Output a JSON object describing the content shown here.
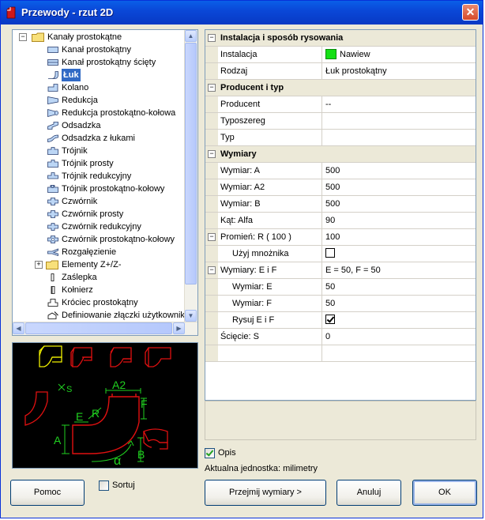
{
  "window": {
    "title": "Przewody - rzut 2D"
  },
  "tree": {
    "root_label": "Kanały prostokątne",
    "items": [
      {
        "label": "Kanał prostokątny",
        "icon": "rect-duct-icon"
      },
      {
        "label": "Kanał prostokątny ścięty",
        "icon": "rect-duct-cut-icon"
      },
      {
        "label": "Łuk",
        "icon": "bend-icon"
      },
      {
        "label": "Kolano",
        "icon": "elbow-icon"
      },
      {
        "label": "Redukcja",
        "icon": "reducer-icon"
      },
      {
        "label": "Redukcja prostokątno-kołowa",
        "icon": "rect-round-reducer-icon"
      },
      {
        "label": "Odsadzka",
        "icon": "offset-icon"
      },
      {
        "label": "Odsadzka z łukami",
        "icon": "offset-bends-icon"
      },
      {
        "label": "Trójnik",
        "icon": "tee-icon"
      },
      {
        "label": "Trójnik prosty",
        "icon": "tee-straight-icon"
      },
      {
        "label": "Trójnik redukcyjny",
        "icon": "tee-reducing-icon"
      },
      {
        "label": "Trójnik prostokątno-kołowy",
        "icon": "tee-rect-round-icon"
      },
      {
        "label": "Czwórnik",
        "icon": "cross-icon"
      },
      {
        "label": "Czwórnik prosty",
        "icon": "cross-straight-icon"
      },
      {
        "label": "Czwórnik redukcyjny",
        "icon": "cross-reducing-icon"
      },
      {
        "label": "Czwórnik prostokątno-kołowy",
        "icon": "cross-rect-round-icon"
      },
      {
        "label": "Rozgałęzienie",
        "icon": "branch-icon"
      }
    ],
    "folder2_label": "Elementy Z+/Z-",
    "items2": [
      {
        "label": "Zaślepka",
        "icon": "cap-icon"
      },
      {
        "label": "Kołnierz",
        "icon": "flange-icon"
      },
      {
        "label": "Króciec prostokątny",
        "icon": "spigot-icon"
      },
      {
        "label": "Definiowanie złączki użytkownik",
        "icon": "user-fitting-icon"
      }
    ]
  },
  "preview": {
    "labels": {
      "a2": "A2",
      "e": "E",
      "r": "R",
      "f": "F",
      "a": "A",
      "b": "B",
      "s": "S",
      "alpha": "α"
    },
    "colors": {
      "red": "#e01010",
      "yellow": "#f0f000",
      "green": "#20d020"
    }
  },
  "properties": {
    "cat1": "Instalacja i sposób rysowania",
    "instalacja_label": "Instalacja",
    "instalacja_value": "Nawiew",
    "instalacja_color": "#14e014",
    "rodzaj_label": "Rodzaj",
    "rodzaj_value": "Łuk prostokątny",
    "cat2": "Producent i typ",
    "producent_label": "Producent",
    "producent_value": "--",
    "typoszereg_label": "Typoszereg",
    "typ_label": "Typ",
    "cat3": "Wymiary",
    "wym_a_label": "Wymiar: A",
    "wym_a_value": "500",
    "wym_a2_label": "Wymiar: A2",
    "wym_a2_value": "500",
    "wym_b_label": "Wymiar: B",
    "wym_b_value": "500",
    "kat_label": "Kąt: Alfa",
    "kat_value": "90",
    "promien_label": "Promień: R  ( 100 )",
    "promien_value": "100",
    "mnoznik_label": "Użyj mnożnika",
    "mnoznik_checked": false,
    "wym_ef_label": "Wymiary: E i F",
    "wym_ef_value": "E = 50,  F = 50",
    "wym_e_label": "Wymiar: E",
    "wym_e_value": "50",
    "wym_f_label": "Wymiar: F",
    "wym_f_value": "50",
    "rysuj_label": "Rysuj E i F",
    "rysuj_checked": true,
    "sciecie_label": "Ścięcie: S",
    "sciecie_value": "0"
  },
  "options": {
    "opis_label": "Opis",
    "opis_checked": true,
    "unit_text": "Aktualna jednostka: milimetry",
    "sortuj_label": "Sortuj",
    "sortuj_checked": false
  },
  "buttons": {
    "pomoc": "Pomoc",
    "przejmij": "Przejmij wymiary >",
    "anuluj": "Anuluj",
    "ok": "OK"
  }
}
